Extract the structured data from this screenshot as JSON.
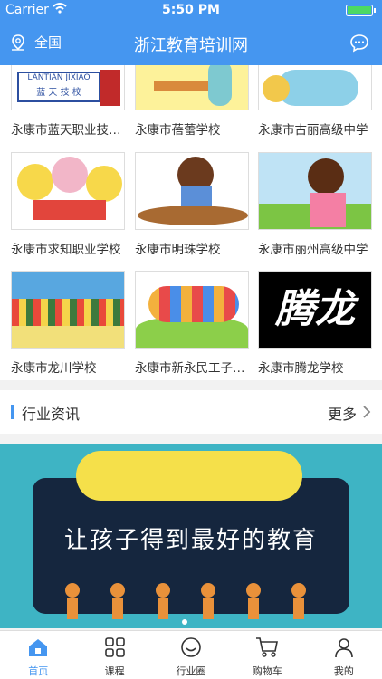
{
  "status": {
    "carrier": "Carrier",
    "time": "5:50 PM"
  },
  "nav": {
    "location": "全国",
    "title": "浙江教育培训网"
  },
  "schools": [
    {
      "name": "永康市蓝天职业技术学校",
      "logo_text": "LANTIAN JIXIAO",
      "logo_cn": "蓝 天 技 校"
    },
    {
      "name": "永康市蓓蕾学校"
    },
    {
      "name": "永康市古丽高级中学"
    },
    {
      "name": "永康市求知职业学校"
    },
    {
      "name": "永康市明珠学校"
    },
    {
      "name": "永康市丽州高级中学"
    },
    {
      "name": "永康市龙川学校"
    },
    {
      "name": "永康市新永民工子弟学校"
    },
    {
      "name": "永康市腾龙学校",
      "logo_text": "腾龙"
    }
  ],
  "news": {
    "title": "行业资讯",
    "more": "更多"
  },
  "banner": {
    "slogan": "让孩子得到最好的教育"
  },
  "tabs": [
    {
      "label": "首页",
      "icon": "home-icon"
    },
    {
      "label": "课程",
      "icon": "grid-icon"
    },
    {
      "label": "行业圈",
      "icon": "smile-icon"
    },
    {
      "label": "购物车",
      "icon": "cart-icon"
    },
    {
      "label": "我的",
      "icon": "user-icon"
    }
  ],
  "colors": {
    "brand": "#4596f0",
    "banner_bg": "#3eb4c4",
    "board": "#15263e"
  }
}
